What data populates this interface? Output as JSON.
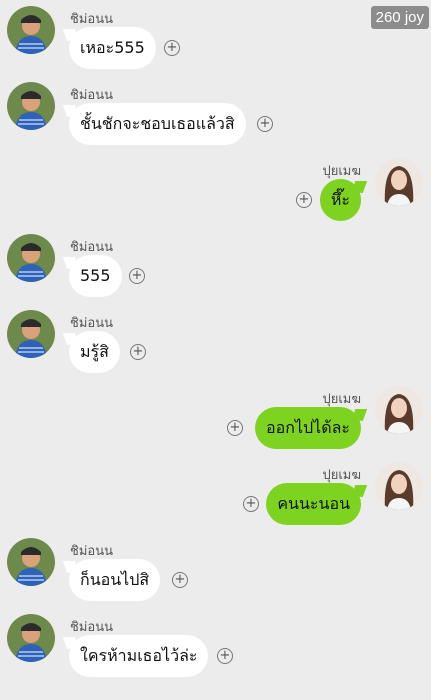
{
  "badge": {
    "text": "260 joy"
  },
  "contacts": {
    "left": {
      "name": "ชิม่อนน",
      "avatar_icon": "person-in-blue-shirt-avatar"
    },
    "right": {
      "name": "ปุยเมฆ",
      "avatar_icon": "long-haired-girl-avatar"
    }
  },
  "messages": [
    {
      "side": "left",
      "name": "ชิม่อนน",
      "text": "เหอะ555"
    },
    {
      "side": "left",
      "name": "ชิม่อนน",
      "text": "ชั้นชักจะชอบเธอแล้วสิ"
    },
    {
      "side": "right",
      "name": "ปุยเมฆ",
      "text": "หึ๊ะ"
    },
    {
      "side": "left",
      "name": "ชิม่อนน",
      "text": "555"
    },
    {
      "side": "left",
      "name": "ชิม่อนน",
      "text": "มรู้สิ"
    },
    {
      "side": "right",
      "name": "ปุยเมฆ",
      "text": "ออกไปได้ละ"
    },
    {
      "side": "right",
      "name": "ปุยเมฆ",
      "text": "คนนะนอน"
    },
    {
      "side": "left",
      "name": "ชิม่อนน",
      "text": "ก็นอนไปสิ"
    },
    {
      "side": "left",
      "name": "ชิม่อนน",
      "text": "ใครห้ามเธอไว้ล่ะ"
    }
  ],
  "colors": {
    "background": "#ececec",
    "incoming_bubble": "#ffffff",
    "outgoing_bubble": "#7ed321",
    "badge": "#8c8c8c"
  }
}
